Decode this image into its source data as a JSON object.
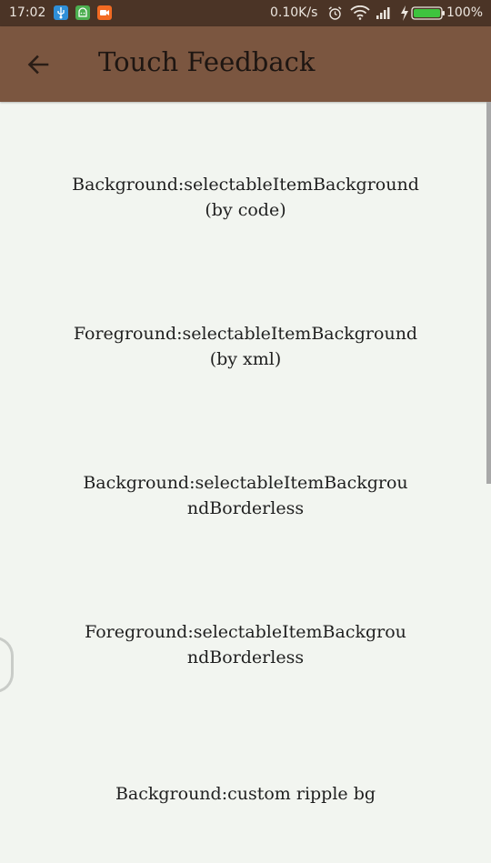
{
  "status_bar": {
    "time": "17:02",
    "network_speed": "0.10K/s",
    "battery_percent": "100%",
    "notification_icons": [
      "usb-icon",
      "android-icon",
      "camera-icon"
    ],
    "colors": {
      "usb": "#2f8fd8",
      "android": "#4caf50",
      "camera": "#f26a22",
      "battery": "#3ec43e"
    }
  },
  "toolbar": {
    "title": "Touch Feedback",
    "back_icon": "arrow-left-icon"
  },
  "items": [
    {
      "line1": "Background:selectableItemBackground",
      "line2": "(by code)"
    },
    {
      "line1": "Foreground:selectableItemBackground",
      "line2": "(by xml)"
    },
    {
      "line1": "Background:selectableItemBackgrou",
      "line2": "ndBorderless"
    },
    {
      "line1": "Foreground:selectableItemBackgrou",
      "line2": "ndBorderless"
    },
    {
      "line1": "Background:custom ripple bg",
      "line2": ""
    }
  ],
  "theme": {
    "status_bar_bg": "#4b3426",
    "toolbar_bg": "#7b5640",
    "content_bg": "#f2f5f0"
  }
}
